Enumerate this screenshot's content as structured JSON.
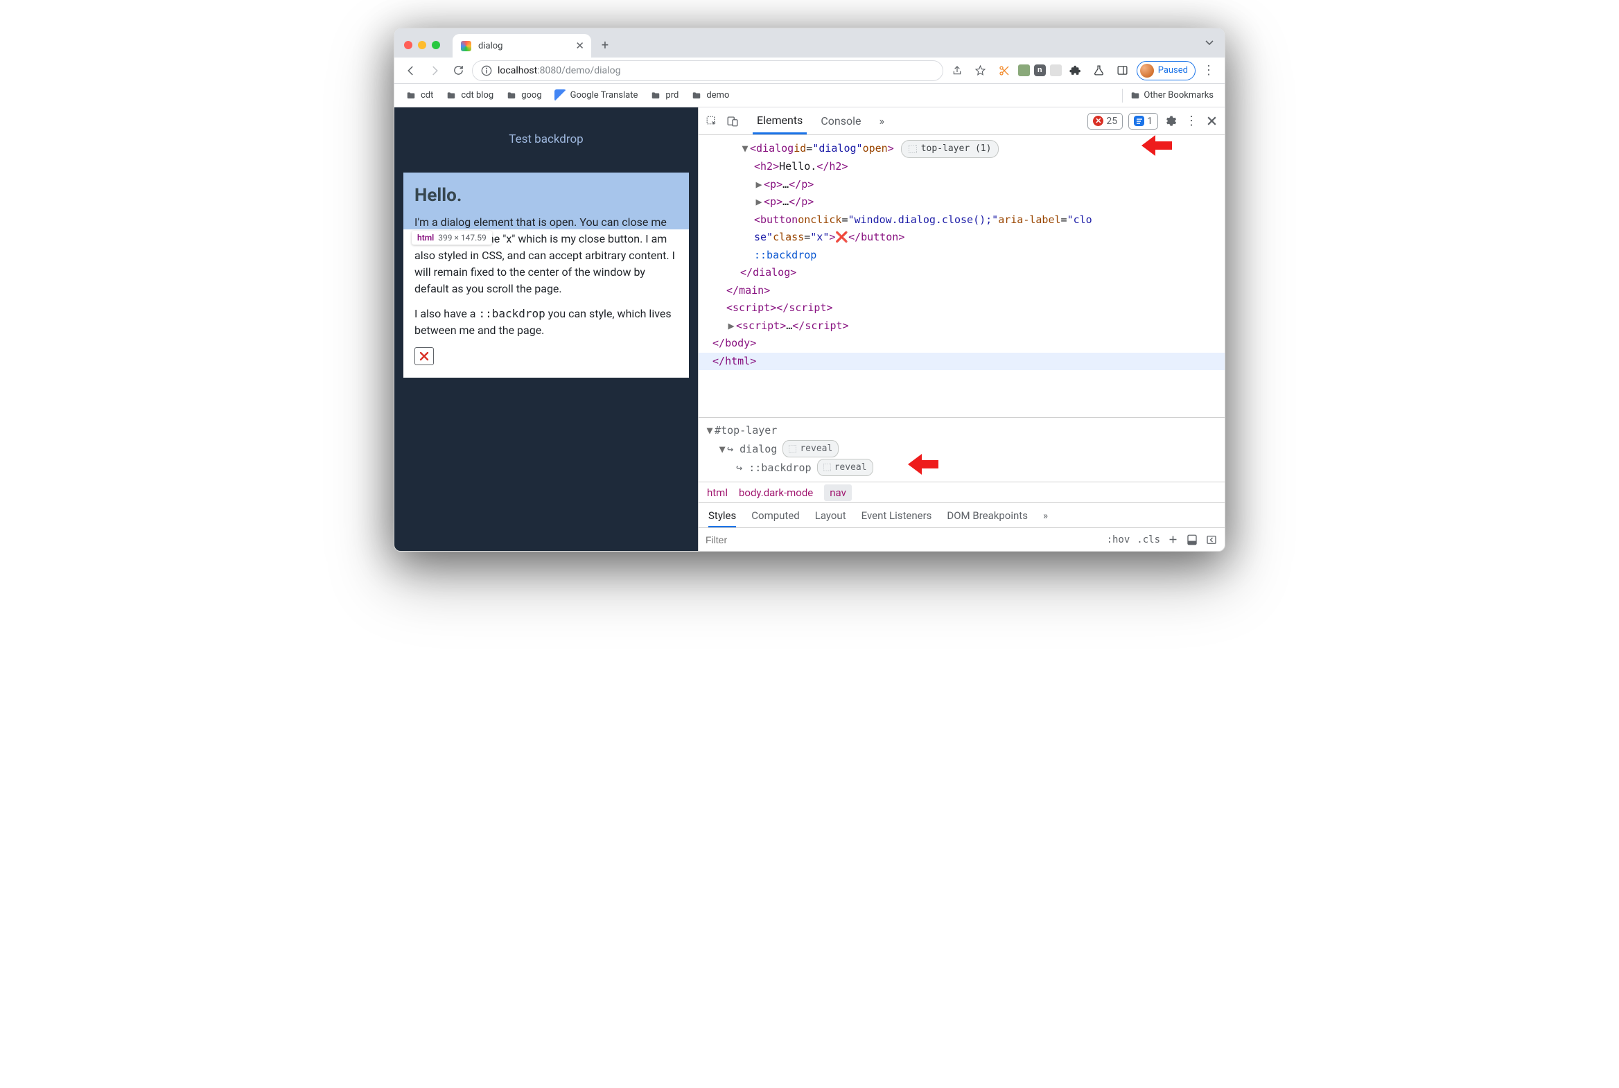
{
  "browser": {
    "tab_title": "dialog",
    "url_host_prefix": "localhost",
    "url_port": ":8080",
    "url_path": "/demo/dialog",
    "paused_label": "Paused",
    "other_bookmarks": "Other Bookmarks",
    "bookmarks": [
      "cdt",
      "cdt blog",
      "goog",
      "Google Translate",
      "prd",
      "demo"
    ]
  },
  "page": {
    "main_button": "Test backdrop",
    "dialog": {
      "heading": "Hello.",
      "p1": "I'm a dialog element that is open. You can close me by clicking on the \"x\" which is my close button. I am also styled in CSS, and can accept arbitrary content. I will remain fixed to the center of the window by default as you scroll the page.",
      "p2_a": "I also have a ",
      "p2_code": "::backdrop",
      "p2_b": " you can style, which lives between me and the page."
    },
    "tooltip_tag": "html",
    "tooltip_dims": "399 × 147.59"
  },
  "devtools": {
    "tabs": {
      "elements": "Elements",
      "console": "Console"
    },
    "more_tabs": "»",
    "error_count": "25",
    "info_count": "1",
    "top_layer_chip": "top-layer (1)",
    "reveal": "reveal",
    "crumbs": {
      "html": "html",
      "body": "body.dark-mode",
      "nav": "nav"
    },
    "subtabs": {
      "styles": "Styles",
      "computed": "Computed",
      "layout": "Layout",
      "listeners": "Event Listeners",
      "dom": "DOM Breakpoints",
      "more": "»"
    },
    "filter_placeholder": "Filter",
    "filter_right": {
      "hov": ":hov",
      "cls": ".cls"
    },
    "tree": {
      "dialog_open": "<dialog id=\"dialog\" open>",
      "h2": "<h2>Hello.</h2>",
      "p_collapsed": "<p>…</p>",
      "button_line1": "<button onclick=\"window.dialog.close();\" aria-label=\"clo",
      "button_line2": "se\" class=\"x\">❌</button>",
      "backdrop": "::backdrop",
      "dialog_close": "</dialog>",
      "main_close": "</main>",
      "script_empty": "<script> </script>",
      "script_collapsed": "<script>…</script>",
      "body_close": "</body>",
      "html_close": "</html>",
      "toplayer_label": "#top-layer",
      "toplayer_dialog": "dialog",
      "toplayer_backdrop": "::backdrop"
    }
  }
}
